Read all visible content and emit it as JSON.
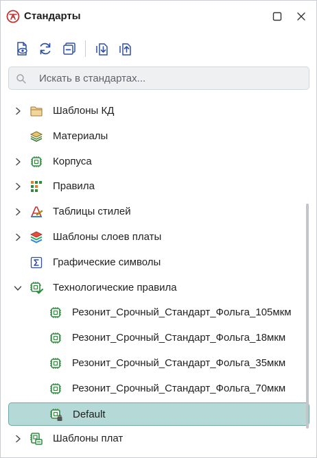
{
  "window": {
    "title": "Стандарты",
    "app_icon": "standards-logo-icon",
    "buttons": [
      "maximize-icon",
      "close-icon"
    ]
  },
  "toolbar": {
    "buttons": [
      "preview-document-icon",
      "refresh-icon",
      "collapse-all-icon",
      "import-icon",
      "export-icon"
    ]
  },
  "search": {
    "placeholder": "Искать в стандартах...",
    "value": ""
  },
  "tree": {
    "items": [
      {
        "label": "Шаблоны КД",
        "icon": "folder-icon",
        "expandable": true,
        "expanded": false,
        "level": 0
      },
      {
        "label": "Материалы",
        "icon": "materials-layers-icon",
        "expandable": false,
        "expanded": false,
        "level": 0
      },
      {
        "label": "Корпуса",
        "icon": "chip-package-icon",
        "expandable": true,
        "expanded": false,
        "level": 0
      },
      {
        "label": "Правила",
        "icon": "rules-grid-icon",
        "expandable": true,
        "expanded": false,
        "level": 0
      },
      {
        "label": "Таблицы стилей",
        "icon": "style-tables-icon",
        "expandable": true,
        "expanded": false,
        "level": 0
      },
      {
        "label": "Шаблоны слоев платы",
        "icon": "board-layers-icon",
        "expandable": true,
        "expanded": false,
        "level": 0
      },
      {
        "label": "Графические символы",
        "icon": "sigma-symbol-icon",
        "expandable": false,
        "expanded": false,
        "level": 0
      },
      {
        "label": "Технологические правила",
        "icon": "tech-rules-check-icon",
        "expandable": true,
        "expanded": true,
        "level": 0
      },
      {
        "label": "Резонит_Срочный_Стандарт_Фольга_105мкм",
        "icon": "chip-package-icon",
        "expandable": false,
        "expanded": false,
        "level": 1
      },
      {
        "label": "Резонит_Срочный_Стандарт_Фольга_18мкм",
        "icon": "chip-package-icon",
        "expandable": false,
        "expanded": false,
        "level": 1
      },
      {
        "label": "Резонит_Срочный_Стандарт_Фольга_35мкм",
        "icon": "chip-package-icon",
        "expandable": false,
        "expanded": false,
        "level": 1
      },
      {
        "label": "Резонит_Срочный_Стандарт_Фольга_70мкм",
        "icon": "chip-package-icon",
        "expandable": false,
        "expanded": false,
        "level": 1
      },
      {
        "label": "Default",
        "icon": "chip-locked-icon",
        "expandable": false,
        "expanded": false,
        "level": 1,
        "selected": true
      },
      {
        "label": "Шаблоны плат",
        "icon": "board-template-icon",
        "expandable": true,
        "expanded": false,
        "level": 0
      }
    ]
  },
  "colors": {
    "accent": "#2f4fa3",
    "green_icon": "#2e8b3e",
    "selection_bg": "#b4d9d6",
    "selection_border": "#6fa9a3",
    "app_icon_red": "#c4322f"
  }
}
